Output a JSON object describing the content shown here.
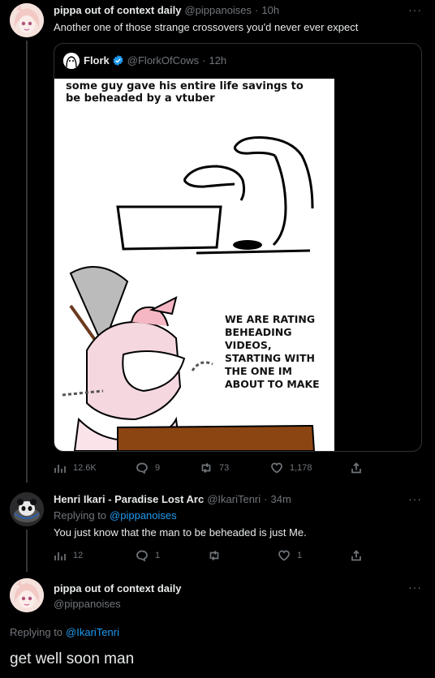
{
  "tweet1": {
    "name": "pippa out of context daily",
    "handle": "@pippanoises",
    "sep": "·",
    "time": "10h",
    "text": "Another one of those strange crossovers you'd never ever expect",
    "more": "···",
    "quote": {
      "name": "Flork",
      "handle": "@FlorkOfCows",
      "sep": "·",
      "time": "12h",
      "meme_caption": "some guy gave his entire life savings to be beheaded by a vtuber",
      "meme_speech": [
        "WE ARE RATING",
        "BEHEADING",
        "VIDEOS,",
        "STARTING WITH",
        "THE ONE IM",
        "ABOUT TO MAKE"
      ]
    },
    "actions": {
      "views": "12.6K",
      "replies": "9",
      "retweets": "73",
      "likes": "1,178"
    }
  },
  "tweet2": {
    "name": "Henri Ikari - Paradise Lost Arc",
    "handle": "@IkariTenri",
    "sep": "·",
    "time": "34m",
    "replying_prefix": "Replying to",
    "replying_to": "@pippanoises",
    "text": "You just know that the man to be beheaded is just Me.",
    "more": "···",
    "actions": {
      "views": "12",
      "replies": "1",
      "retweets": "",
      "likes": "1"
    }
  },
  "tweet3": {
    "name": "pippa out of context daily",
    "handle": "@pippanoises",
    "more": "···",
    "replying_prefix": "Replying to",
    "replying_to": "@IkariTenri",
    "text": "get well soon man"
  },
  "colors": {
    "background": "#000000",
    "text": "#e7e9ea",
    "muted": "#71767b",
    "link": "#1d9bf0",
    "verified": "#1d9bf0"
  }
}
